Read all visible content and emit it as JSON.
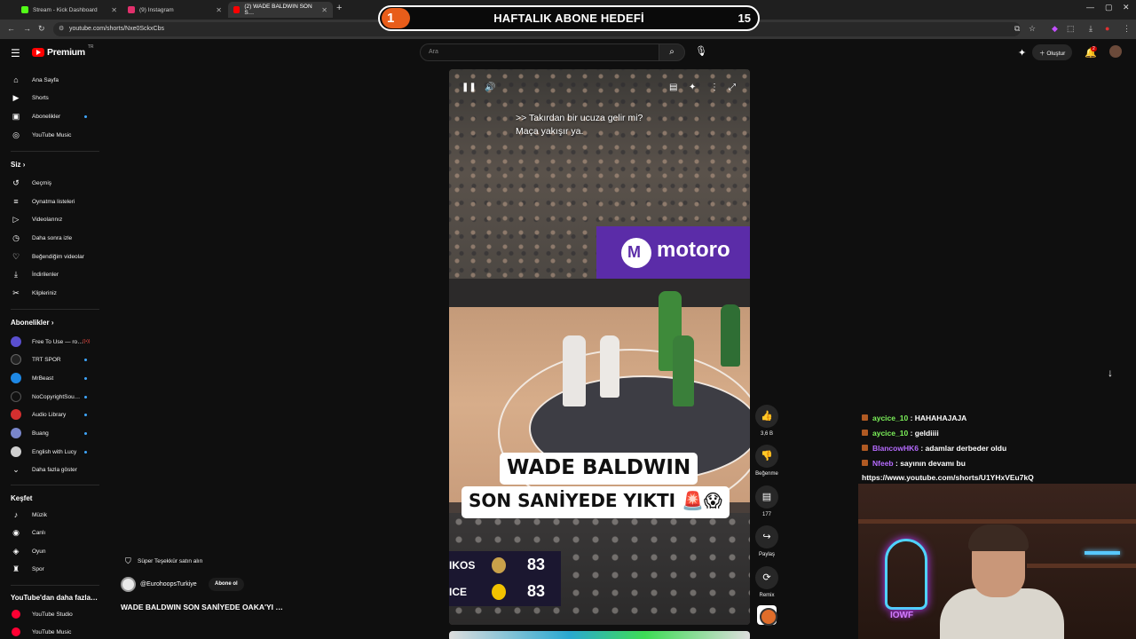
{
  "browser": {
    "tabs": [
      {
        "title": "Stream - Kick Dashboard",
        "color": "#53fc18"
      },
      {
        "title": "(9) Instagram",
        "color": "#e1306c"
      },
      {
        "title": "(2) WADE BALDWIN SON S…",
        "color": "#ff0000"
      }
    ],
    "url": "youtube.com/shorts/Nxe0SckxCbs"
  },
  "overlay": {
    "goal_number": "1",
    "goal_title": "HAFTALIK ABONE HEDEFİ",
    "goal_count": "15"
  },
  "header": {
    "logo_text": "Premium",
    "logo_region": "TR",
    "search_placeholder": "Ara",
    "create_label": "Oluştur",
    "notif_count": "2"
  },
  "sidebar": {
    "main": [
      {
        "label": "Ana Sayfa",
        "icon": "home-icon",
        "glyph": "⌂"
      },
      {
        "label": "Shorts",
        "icon": "shorts-icon",
        "glyph": "▶"
      },
      {
        "label": "Abonelikler",
        "icon": "subscriptions-icon",
        "glyph": "▣"
      },
      {
        "label": "YouTube Music",
        "icon": "music-icon",
        "glyph": "◎"
      }
    ],
    "you_heading": "Siz",
    "you": [
      {
        "label": "Geçmiş",
        "icon": "history-icon",
        "glyph": "↺"
      },
      {
        "label": "Oynatma listeleri",
        "icon": "playlists-icon",
        "glyph": "≡"
      },
      {
        "label": "Videolarınız",
        "icon": "your-videos-icon",
        "glyph": "▷"
      },
      {
        "label": "Daha sonra izle",
        "icon": "watch-later-icon",
        "glyph": "◷"
      },
      {
        "label": "Beğendiğim videolar",
        "icon": "liked-icon",
        "glyph": "👍"
      },
      {
        "label": "İndirilenler",
        "icon": "downloads-icon",
        "glyph": "⤓"
      },
      {
        "label": "Klipleriniz",
        "icon": "clips-icon",
        "glyph": "✂"
      }
    ],
    "subs_heading": "Abonelikler",
    "subs": [
      {
        "label": "Free To Use — ro…",
        "color": "#5a4fcf",
        "live": "((•))"
      },
      {
        "label": "TRT SPOR",
        "color": "#222222",
        "live": ""
      },
      {
        "label": "MrBeast",
        "color": "#1e88e5",
        "live": ""
      },
      {
        "label": "NoCopyrightSou…",
        "color": "#111111",
        "live": ""
      },
      {
        "label": "Audio Library",
        "color": "#d32f2f",
        "live": ""
      },
      {
        "label": "Buang",
        "color": "#7986cb",
        "live": ""
      },
      {
        "label": "English with Lucy",
        "color": "#cfcfcf",
        "live": ""
      }
    ],
    "show_more": "Daha fazla göster",
    "explore_heading": "Keşfet",
    "explore": [
      {
        "label": "Müzik",
        "icon": "music-note-icon",
        "glyph": "♪"
      },
      {
        "label": "Canlı",
        "icon": "live-icon",
        "glyph": "◉"
      },
      {
        "label": "Oyun",
        "icon": "gaming-icon",
        "glyph": "◈"
      },
      {
        "label": "Spor",
        "icon": "trophy-icon",
        "glyph": "♜"
      }
    ],
    "more_heading": "YouTube'dan daha fazla…",
    "more": [
      {
        "label": "YouTube Studio",
        "color": "#ff0033"
      },
      {
        "label": "YouTube Music",
        "color": "#ff0033"
      }
    ]
  },
  "video": {
    "caption_line1": ">> Takırdan bir ucuza gelir mi?",
    "caption_line2": "Maça yakışır ya.",
    "ad_text": "motoro",
    "headline_line1": "WADE BALDWIN",
    "headline_line2": "SON SANİYEDE YIKTI 🚨😱",
    "score": [
      {
        "team": "IKOS",
        "score": "83",
        "logo_color": "#c9a14a"
      },
      {
        "team": "ICE",
        "score": "83",
        "logo_color": "#f2c200"
      }
    ]
  },
  "actions": {
    "like_count": "3,6 B",
    "dislike_label": "Beğenme",
    "comment_count": "177",
    "share_label": "Paylaş",
    "remix_label": "Remix"
  },
  "channel": {
    "thanks_label": "Süper Teşekkür satın alın",
    "handle": "@EurohoopsTurkiye",
    "subscribe_label": "Abone ol",
    "title": "WADE BALDWIN SON SANİYEDE OAKA'YI …"
  },
  "chat": {
    "messages": [
      {
        "user": "aycice_10",
        "text": ": HAHAHAJAJA",
        "color": "#7cf25a"
      },
      {
        "user": "aycice_10",
        "text": ": geldiiii",
        "color": "#7cf25a"
      },
      {
        "user": "BlancowHK6",
        "text": ": adamlar derbeder oldu",
        "color": "#b66bff"
      },
      {
        "user": "Nfeeb",
        "text": ": sayının devamı bu",
        "color": "#b66bff"
      }
    ],
    "url_line": "https://www.youtube.com/shorts/U1YHxVEu7kQ"
  },
  "webcam": {
    "neon_text": "IOWF"
  }
}
